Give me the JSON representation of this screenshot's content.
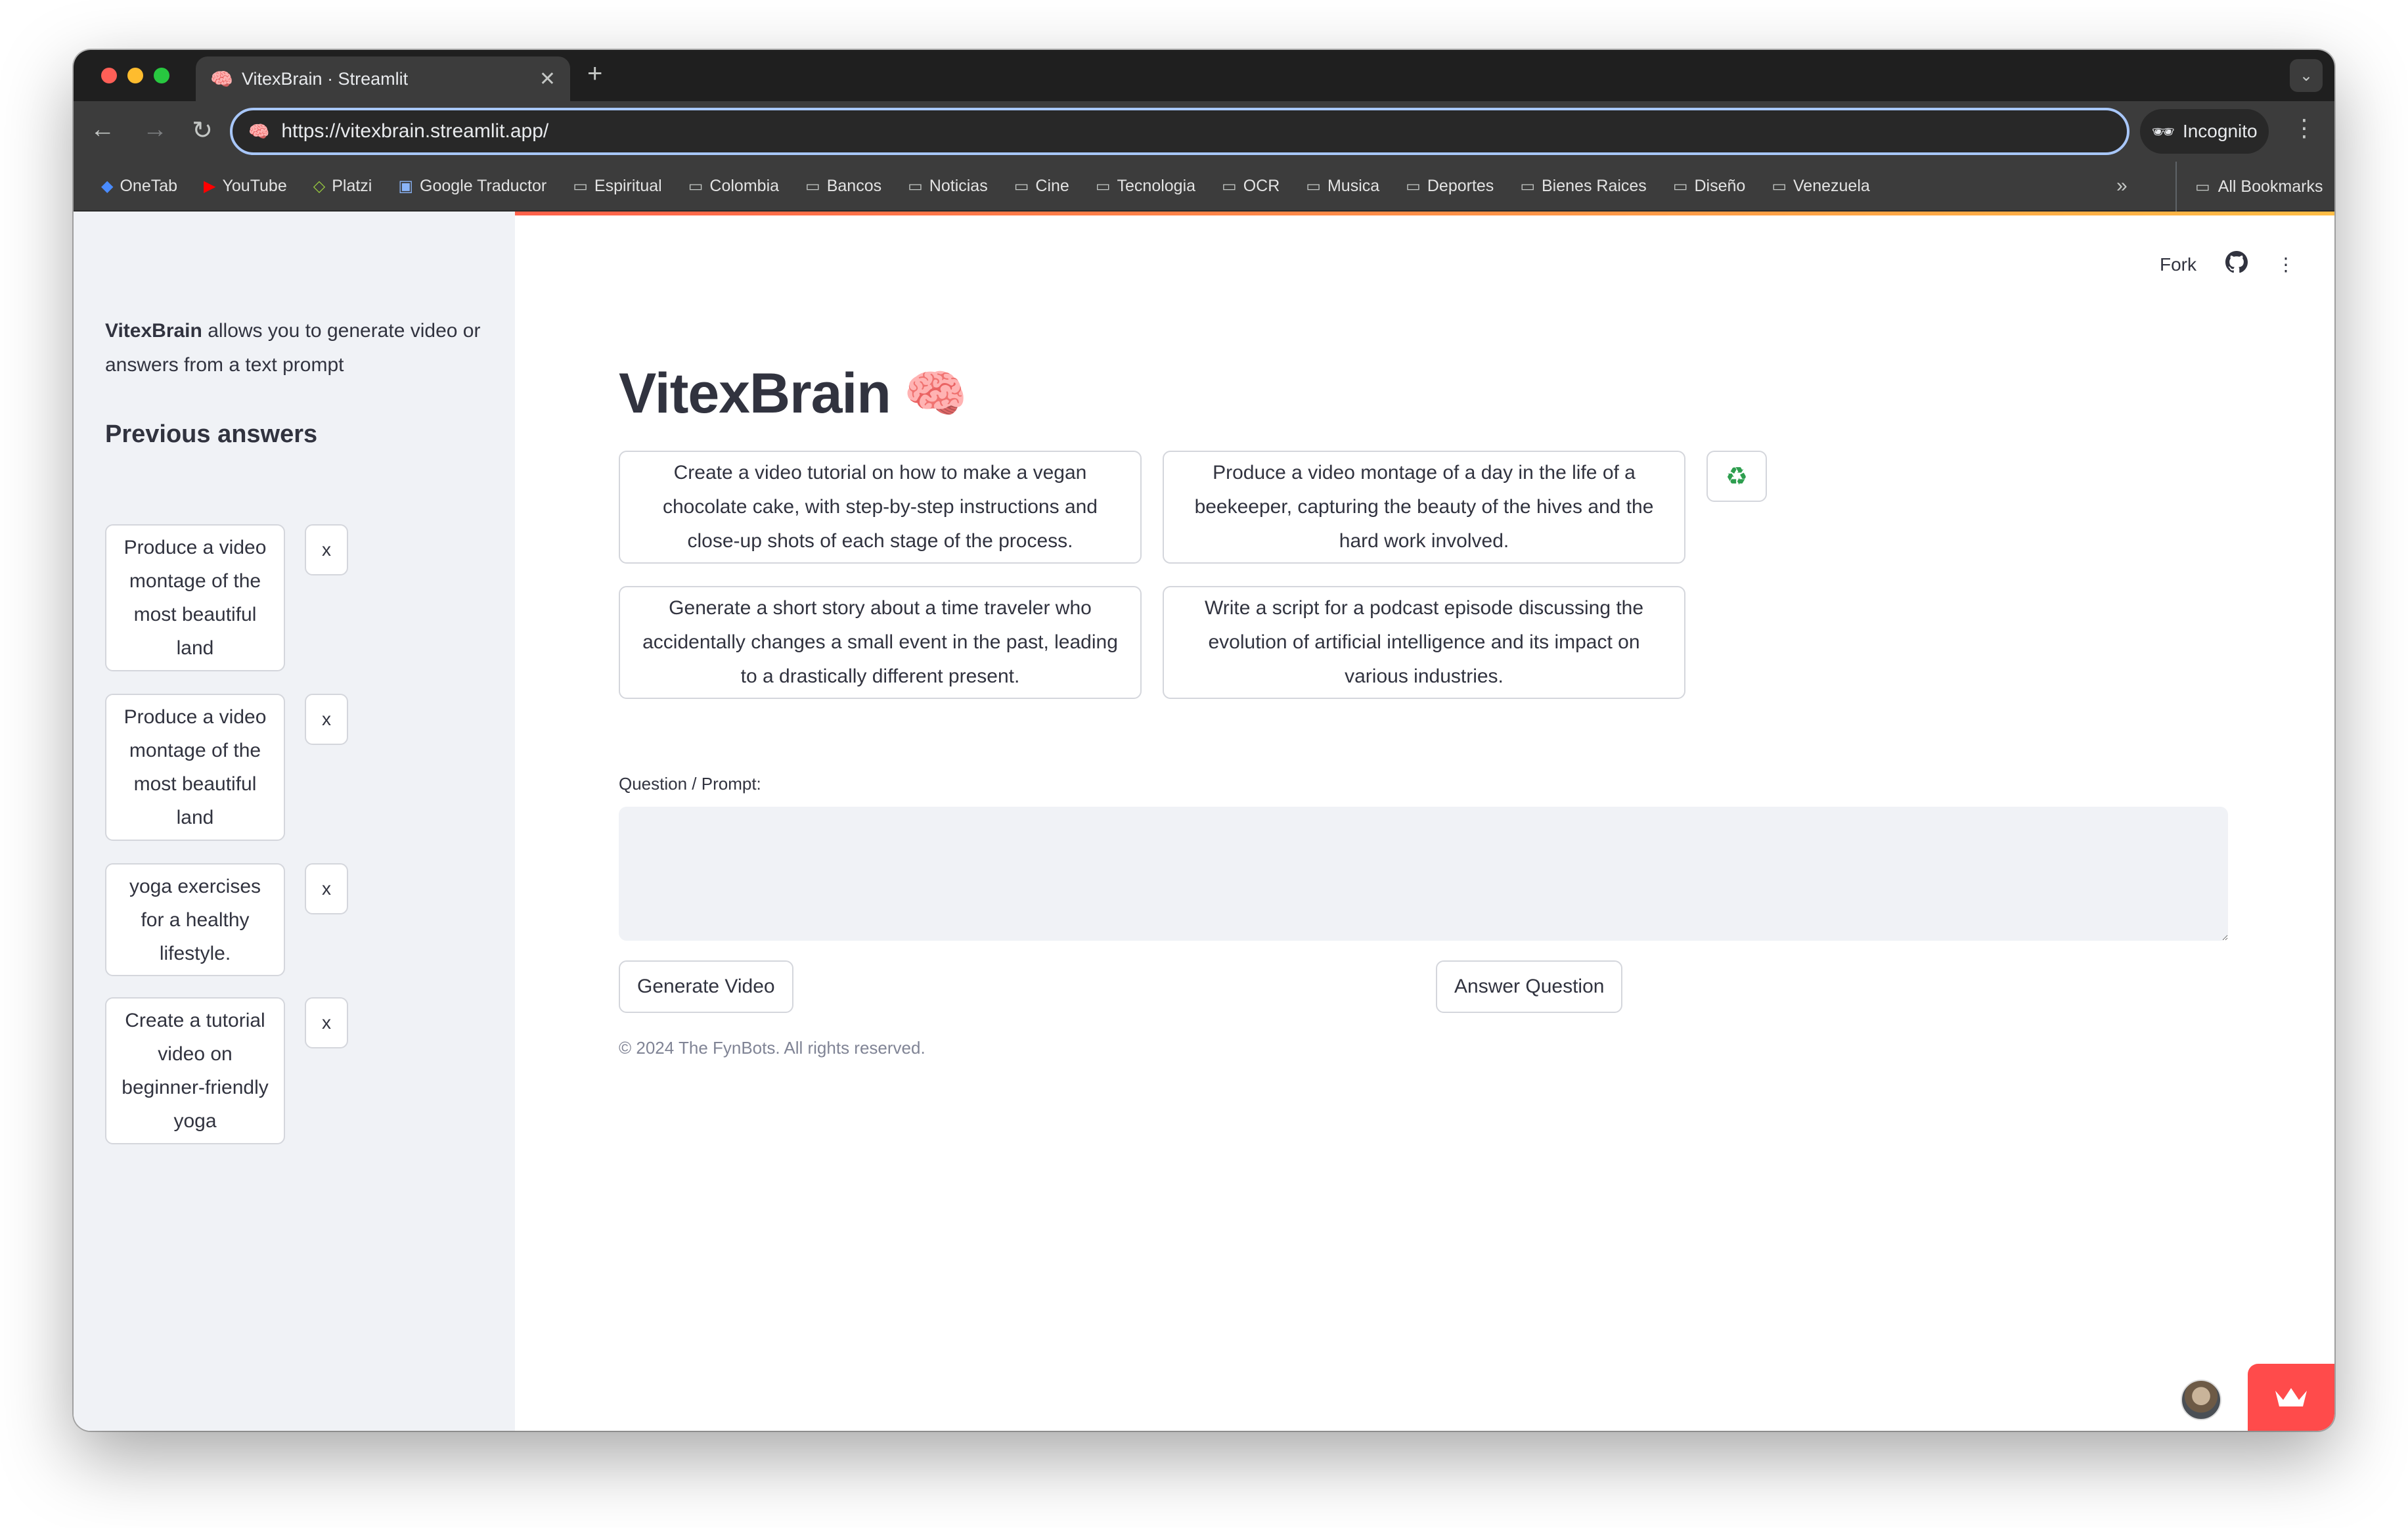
{
  "browser": {
    "tab_title": "VitexBrain · Streamlit",
    "tab_close": "✕",
    "new_tab": "+",
    "url": "https://vitexbrain.streamlit.app/",
    "incognito_label": "Incognito",
    "bookmarks": [
      "OneTab",
      "YouTube",
      "Platzi",
      "Google Traductor",
      "Espiritual",
      "Colombia",
      "Bancos",
      "Noticias",
      "Cine",
      "Tecnologia",
      "OCR",
      "Musica",
      "Deportes",
      "Bienes Raices",
      "Diseño",
      "Venezuela"
    ],
    "bookmarks_more": "»",
    "all_bookmarks": "All Bookmarks"
  },
  "header": {
    "fork_label": "Fork"
  },
  "sidebar": {
    "desc_bold": "VitexBrain",
    "desc_rest": " allows you to generate video or answers from a text prompt",
    "heading": "Previous answers",
    "items": [
      {
        "label": "Produce a video montage of the most beautiful land",
        "remove": "x"
      },
      {
        "label": "Produce a video montage of the most beautiful land",
        "remove": "x"
      },
      {
        "label": "yoga exercises for a healthy lifestyle.",
        "remove": "x"
      },
      {
        "label": "Create a tutorial video on beginner-friendly yoga",
        "remove": "x"
      }
    ]
  },
  "main": {
    "title": "VitexBrain",
    "title_emoji": "🧠",
    "suggestions": [
      "Create a video tutorial on how to make a vegan chocolate cake, with step-by-step instructions and close-up shots of each stage of the process.",
      "Produce a video montage of a day in the life of a beekeeper, capturing the beauty of the hives and the hard work involved.",
      "Generate a short story about a time traveler who accidentally changes a small event in the past, leading to a drastically different present.",
      "Write a script for a podcast episode discussing the evolution of artificial intelligence and its impact on various industries."
    ],
    "refresh_icon": "♻",
    "prompt_label": "Question / Prompt:",
    "prompt_value": "",
    "generate_video": "Generate Video",
    "answer_question": "Answer Question",
    "footer": "© 2024 The FynBots. All rights reserved."
  },
  "colors": {
    "accent": "#ff4b4b",
    "sidebar_bg": "#f0f2f6",
    "text": "#31333f"
  }
}
